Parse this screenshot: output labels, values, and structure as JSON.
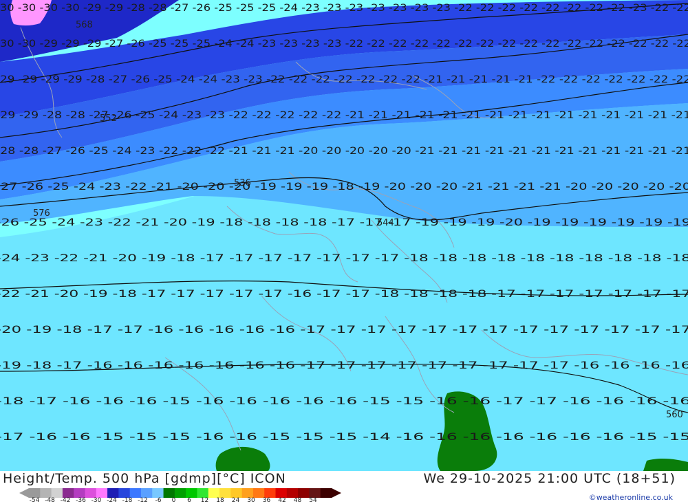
{
  "header": {
    "title": "Height/Temp. 500 hPa [gdmp][°C] ICON",
    "datetime": "We 29-10-2025 21:00 UTC (18+51)",
    "credit": "©weatheronline.co.uk"
  },
  "colorbar": {
    "labels": [
      "-54",
      "-48",
      "-42",
      "-36",
      "-30",
      "-24",
      "-18",
      "-12",
      "-6",
      "0",
      "6",
      "12",
      "18",
      "24",
      "30",
      "36",
      "42",
      "48",
      "54"
    ],
    "colors": [
      "#9a9a9a",
      "#b4b4b4",
      "#d2d2d2",
      "#8a2b8f",
      "#b43cc0",
      "#dc50dc",
      "#ff78ff",
      "#1e1eb4",
      "#2846dc",
      "#3c78ff",
      "#5aa0ff",
      "#78c8ff",
      "#007800",
      "#00a000",
      "#00c800",
      "#32e632",
      "#ffff50",
      "#ffe03c",
      "#ffc828",
      "#ffa01e",
      "#ff7814",
      "#ff3c0a",
      "#dc0000",
      "#b40000",
      "#8c0000",
      "#641414",
      "#3c0000"
    ]
  },
  "map": {
    "colors": {
      "band_m31": "#ff96ff",
      "band_m30": "#1e28c8",
      "band_m27": "#2846e6",
      "band_m24": "#3264f0",
      "band_m21": "#3c8cff",
      "band_m18": "#50b4ff",
      "band_m15": "#6ee6ff",
      "band_m12": "#7dffff",
      "land_green": "#0a7d0a",
      "contour": "#101010",
      "border": "#9aa2b8"
    },
    "labels": [
      "560",
      "544",
      "576",
      "552",
      "536",
      "568",
      "552"
    ],
    "temperature_rows": [
      "-30 -30 -30 -30 -29 -29 -28 -28 -27 -26 -25 -25 -25 -24 -23 -23 -23 -23 -23 -23 -23 -22 -22 -22 -22 -22 -22 -22 -22 -23 -22 -22",
      "-30 -30 -29 -29 -29 -27 -26 -25 -25 -25 -24 -24 -23 -23 -23 -23 -22 -22 -22 -22 -22 -22 -22 -22 -22 -22 -22 -22 -22 -22 -22 -22",
      "-29 -29 -29 -29 -28 -27 -26 -25 -24 -24 -23 -23 -22 -22 -22 -22 -22 -22 -22 -21 -21 -21 -21 -21 -22 -22 -22 -22 -22 -22 -22",
      "-29 -29 -28 -28 -27 -26 -25 -24 -23 -23 -22 -22 -22 -22 -22 -21 -21 -21 -21 -21 -21 -21 -21 -21 -21 -21 -21 -21 -21 -21",
      "-28 -28 -27 -26 -25 -24 -23 -22 -22 -22 -21 -21 -21 -20 -20 -20 -20 -20 -21 -21 -21 -21 -21 -21 -21 -21 -21 -21 -21 -21",
      "-27 -26 -25 -24 -23 -22 -21 -20 -20 -20 -19 -19 -19 -18 -19 -20 -20 -20 -21 -21 -21 -21 -20 -20 -20 -20 -20",
      "-26 -25 -24 -23 -22 -21 -20 -19 -18 -18 -18 -18 -17 -17 -17 -19 -19 -19 -20 -19 -19 -19 -19 -19 -19",
      "-24 -23 -22 -21 -20 -19 -18 -17 -17 -17 -17 -17 -17 -17 -18 -18 -18 -18 -18 -18 -18 -18 -18 -18",
      "-22 -21 -20 -19 -18 -17 -17 -17 -17 -17 -16 -17 -17 -18 -18 -18 -18 -17 -17 -17 -17 -17 -17 -17",
      "-20 -19 -18 -17 -17 -16 -16 -16 -16 -16 -17 -17 -17 -17 -17 -17 -17 -17 -17 -17 -17 -17 -17",
      "-19 -18 -17 -16 -16 -16 -16 -16 -16 -16 -17 -17 -17 -17 -17 -17 -17 -17 -17 -16 -16 -16 -16",
      "-18 -17 -16 -16 -16 -15 -16 -16 -16 -16 -16 -15 -15 -16 -16 -17 -17 -16 -16 -16 -16",
      "-17 -16 -16 -15 -15 -15 -16 -16 -15 -15 -15 -14 -16 -16 -16 -16 -16 -16 -16 -15 -15"
    ]
  }
}
